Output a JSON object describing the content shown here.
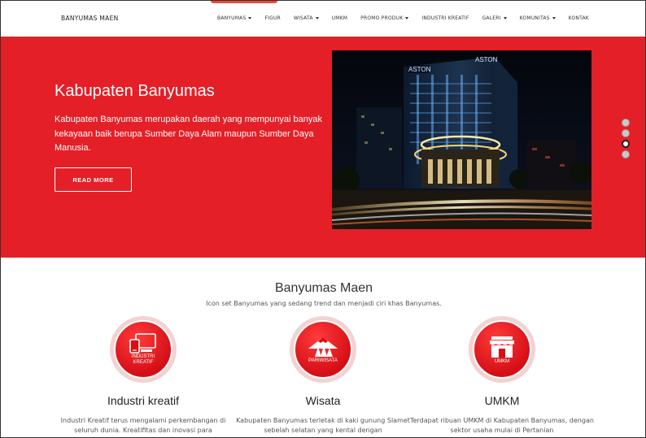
{
  "navbar": {
    "brand": "BANYUMAS MAEN",
    "items": [
      {
        "label": "BANYUMAS",
        "dropdown": true
      },
      {
        "label": "FIGUR",
        "dropdown": false
      },
      {
        "label": "WISATA",
        "dropdown": true
      },
      {
        "label": "UMKM",
        "dropdown": false
      },
      {
        "label": "PROMO PRODUK",
        "dropdown": true
      },
      {
        "label": "INDUSTRI KREATIF",
        "dropdown": false
      },
      {
        "label": "GALERI",
        "dropdown": true
      },
      {
        "label": "KOMUNITAS",
        "dropdown": true
      },
      {
        "label": "KONTAK",
        "dropdown": false
      }
    ]
  },
  "hero": {
    "title": "Kabupaten Banyumas",
    "text": "Kabupaten Banyumas merupakan daerah yang mempunyai banyak kekayaan baik berupa Sumber Daya Alam maupun Sumber Daya Manusia.",
    "button": "READ MORE",
    "slider": {
      "count": 4,
      "active_index": 2
    },
    "accent_color": "#e51f27"
  },
  "section": {
    "title": "Banyumas Maen",
    "subtitle": "Icon set Banyumas yang sedang trend dan menjadi ciri khas Banyumas."
  },
  "features": [
    {
      "icon": "devices-icon",
      "badge_label_1": "INDUSTRI",
      "badge_label_2": "KREATIF",
      "title": "Industri kreatif",
      "text": "Industri Kreatif terus mengalami perkembangan di seluruh dunia. Kreatifitas dan inovasi para"
    },
    {
      "icon": "mountain-trees-icon",
      "badge_label_1": "PARIWISATA",
      "badge_label_2": "",
      "title": "Wisata",
      "text": "Kabupaten Banyumas terletak di kaki gunung Slamet sebelah selatan yang kental dengan"
    },
    {
      "icon": "shop-icon",
      "badge_label_1": "UMKM",
      "badge_label_2": "",
      "title": "UMKM",
      "text": "Terdapat ribuan UMKM di Kabupaten Banyumas, dengan sektor usaha mulai di Pertanian"
    }
  ]
}
